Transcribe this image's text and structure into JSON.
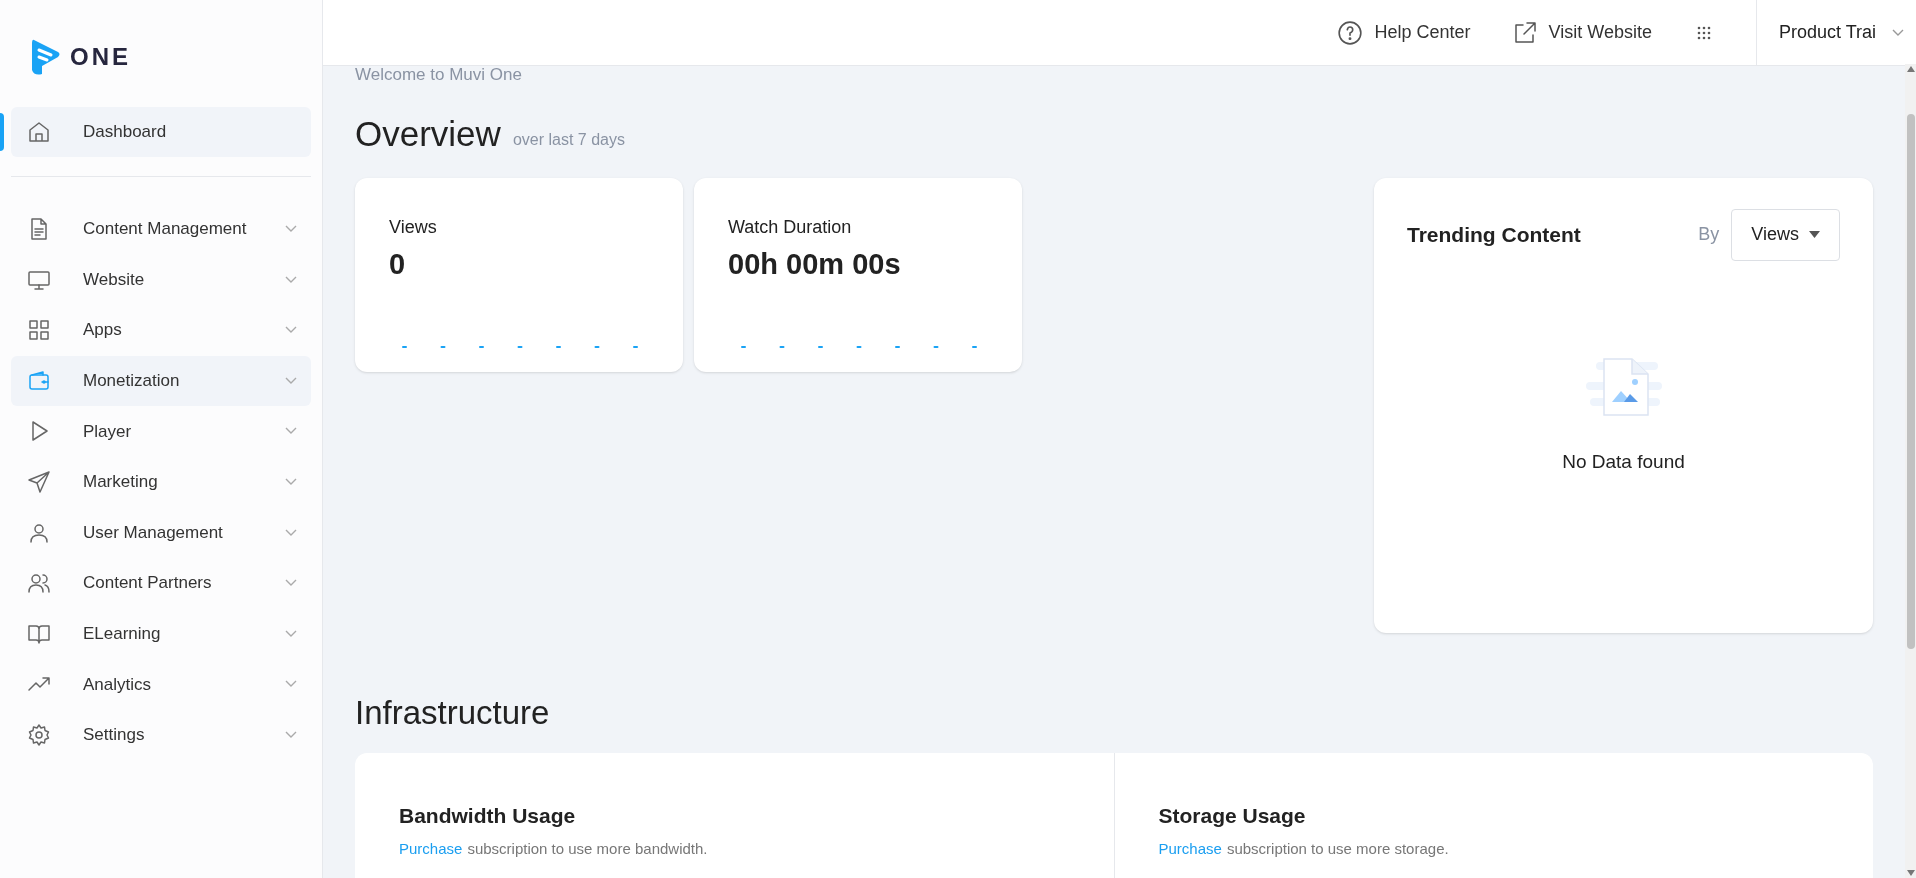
{
  "sidebar": {
    "logo": "ONE",
    "items": [
      {
        "label": "Dashboard",
        "kind": "link",
        "selected": true,
        "hovered": false
      },
      {
        "label": "Content Management",
        "kind": "group",
        "selected": false,
        "hovered": false
      },
      {
        "label": "Website",
        "kind": "group",
        "selected": false,
        "hovered": false
      },
      {
        "label": "Apps",
        "kind": "group",
        "selected": false,
        "hovered": false
      },
      {
        "label": "Monetization",
        "kind": "group",
        "selected": false,
        "hovered": true
      },
      {
        "label": "Player",
        "kind": "group",
        "selected": false,
        "hovered": false
      },
      {
        "label": "Marketing",
        "kind": "group",
        "selected": false,
        "hovered": false
      },
      {
        "label": "User Management",
        "kind": "group",
        "selected": false,
        "hovered": false
      },
      {
        "label": "Content Partners",
        "kind": "group",
        "selected": false,
        "hovered": false
      },
      {
        "label": "ELearning",
        "kind": "group",
        "selected": false,
        "hovered": false
      },
      {
        "label": "Analytics",
        "kind": "group",
        "selected": false,
        "hovered": false
      },
      {
        "label": "Settings",
        "kind": "group",
        "selected": false,
        "hovered": false
      }
    ]
  },
  "header": {
    "links": [
      "Help Center",
      "Visit Website"
    ],
    "account": "Product Trai"
  },
  "welcome": "Welcome to Muvi One",
  "overview": {
    "title": "Overview",
    "subtitle": "over last 7 days",
    "cards": [
      {
        "label": "Views",
        "value": "0"
      },
      {
        "label": "Watch Duration",
        "value": "00h 00m 00s"
      }
    ]
  },
  "trending": {
    "title": "Trending Content",
    "by_label": "By",
    "sort": "Views",
    "empty_text": "No Data found"
  },
  "infrastructure": {
    "title": "Infrastructure",
    "panels": [
      {
        "title": "Bandwidth Usage",
        "link": "Purchase",
        "text": "subscription to use more bandwidth."
      },
      {
        "title": "Storage Usage",
        "link": "Purchase",
        "text": "subscription to use more storage."
      }
    ]
  }
}
